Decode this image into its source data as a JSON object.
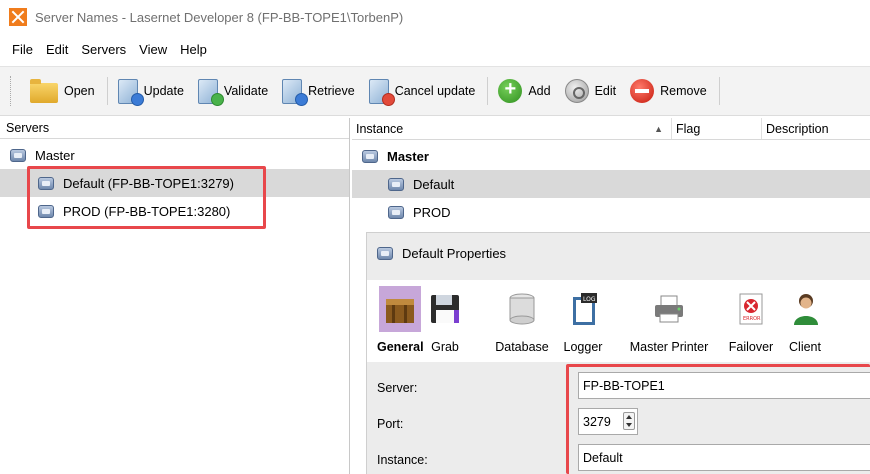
{
  "window": {
    "title": "Server Names - Lasernet Developer 8 (FP-BB-TOPE1\\TorbenP)"
  },
  "menu": [
    {
      "label": "File"
    },
    {
      "label": "Edit"
    },
    {
      "label": "Servers"
    },
    {
      "label": "View"
    },
    {
      "label": "Help"
    }
  ],
  "toolbar": {
    "open": "Open",
    "update": "Update",
    "validate": "Validate",
    "retrieve": "Retrieve",
    "cancel_update": "Cancel update",
    "add": "Add",
    "edit": "Edit",
    "remove": "Remove"
  },
  "left_pane": {
    "header": "Servers",
    "tree": {
      "root": "Master",
      "children": [
        "Default (FP-BB-TOPE1:3279)",
        "PROD (FP-BB-TOPE1:3280)"
      ]
    }
  },
  "right_pane": {
    "columns": [
      "Instance",
      "Flag",
      "Description"
    ],
    "rows": [
      {
        "label": "Master"
      },
      {
        "label": "Default"
      },
      {
        "label": "PROD"
      }
    ]
  },
  "properties": {
    "title": "Default Properties",
    "tabs": [
      "General",
      "Grab",
      "Database",
      "Logger",
      "Master Printer",
      "Failover",
      "Client"
    ],
    "active_tab": "General",
    "fields": {
      "server_label": "Server:",
      "server_value": "FP-BB-TOPE1",
      "port_label": "Port:",
      "port_value": "3279",
      "instance_label": "Instance:",
      "instance_value": "Default"
    }
  },
  "colors": {
    "highlight_box": "#e8474b",
    "selection": "#d9d9d9",
    "active_tab": "#c7a7d9",
    "app_icon": "#f07c1c"
  }
}
